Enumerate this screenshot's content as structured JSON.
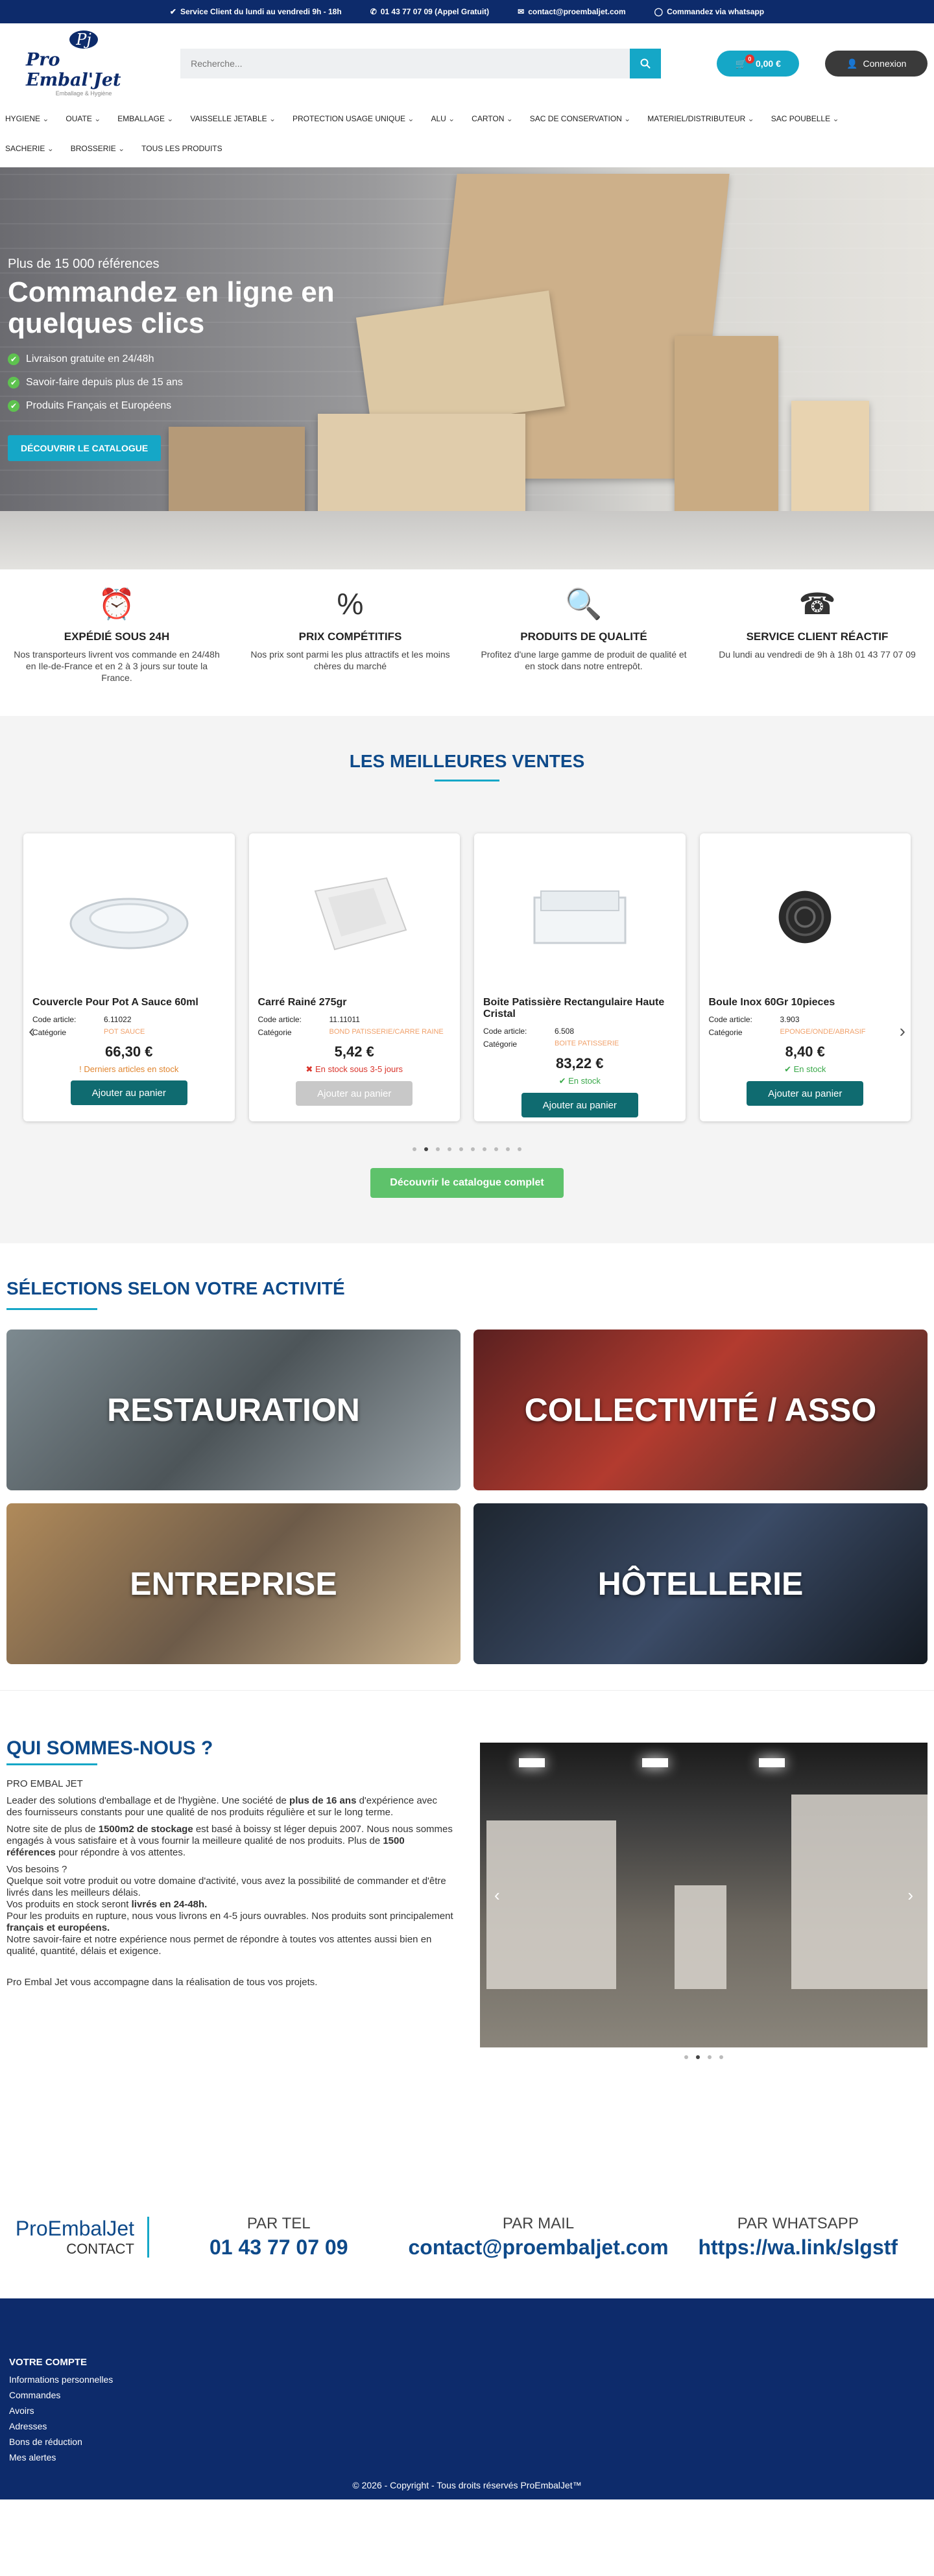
{
  "topbar": {
    "service": "Service Client du lundi au vendredi 9h - 18h",
    "phone": "01 43 77 07 09 (Appel Gratuit)",
    "email": "contact@proembaljet.com",
    "whatsapp": "Commandez via whatsapp"
  },
  "header": {
    "logo_mark": "Pj",
    "logo_name": "Pro Embal'Jet",
    "logo_tag": "Emballage & Hygiène",
    "search_placeholder": "Recherche...",
    "cart_count": "0",
    "cart_total": "0,00 €",
    "login": "Connexion"
  },
  "nav": {
    "row1": [
      "HYGIENE",
      "OUATE",
      "EMBALLAGE",
      "VAISSELLE JETABLE",
      "PROTECTION USAGE UNIQUE",
      "ALU",
      "CARTON",
      "SAC DE CONSERVATION",
      "MATERIEL/DISTRIBUTEUR",
      "SAC POUBELLE"
    ],
    "row2": [
      "SACHERIE",
      "BROSSERIE",
      "TOUS LES PRODUITS"
    ]
  },
  "hero": {
    "kicker": "Plus de 15 000 références",
    "title": "Commandez en ligne en quelques clics",
    "bullets": [
      "Livraison gratuite en 24/48h",
      "Savoir-faire depuis plus de 15 ans",
      "Produits Français et Européens"
    ],
    "cta": "DÉCOUVRIR LE CATALOGUE"
  },
  "features": [
    {
      "icon": "⏰",
      "title": "EXPÉDIÉ SOUS 24H",
      "text": "Nos transporteurs livrent vos commande en 24/48h en Ile-de-France et en 2 à 3 jours sur toute la France."
    },
    {
      "icon": "%",
      "title": "PRIX COMPÉTITIFS",
      "text": "Nos prix sont parmi les plus attractifs et les moins chères du marché"
    },
    {
      "icon": "🔍",
      "title": "PRODUITS DE QUALITÉ",
      "text": "Profitez d'une large gamme de produit de qualité et en stock dans notre entrepôt."
    },
    {
      "icon": "☎",
      "title": "SERVICE CLIENT RÉACTIF",
      "text": "Du lundi au vendredi de 9h à 18h 01 43 77 07 09"
    }
  ],
  "best": {
    "title": "LES MEILLEURES VENTES",
    "code_label": "Code article:",
    "cat_label": "Catégorie",
    "discover": "Découvrir le catalogue complet",
    "products": [
      {
        "name": "Couvercle Pour Pot A Sauce 60ml",
        "code": "6.11022",
        "cat": "POT SAUCE",
        "price": "66,30 €",
        "stock": "Derniers articles en stock",
        "stock_color": "#e0852f",
        "stock_icon": "!",
        "btn": "Ajouter au panier",
        "disabled": false
      },
      {
        "name": "Carré Rainé 275gr",
        "code": "11.11011",
        "cat": "BOND PATISSERIE/CARRE RAINE",
        "price": "5,42 €",
        "stock": "En stock sous 3-5 jours",
        "stock_color": "#d9342b",
        "stock_icon": "✖",
        "btn": "Ajouter au panier",
        "disabled": true
      },
      {
        "name": "Boite Patissière Rectangulaire Haute Cristal",
        "code": "6.508",
        "cat": "BOITE PATISSERIE",
        "price": "83,22 €",
        "stock": "En stock",
        "stock_color": "#3aa94a",
        "stock_icon": "✔",
        "btn": "Ajouter au panier",
        "disabled": false
      },
      {
        "name": "Boule Inox 60Gr 10pieces",
        "code": "3.903",
        "cat": "EPONGE/ONDE/ABRASIF",
        "price": "8,40 €",
        "stock": "En stock",
        "stock_color": "#3aa94a",
        "stock_icon": "✔",
        "btn": "Ajouter au panier",
        "disabled": false
      }
    ]
  },
  "activity": {
    "title": "SÉLECTIONS SELON VOTRE ACTIVITÉ",
    "tiles": [
      "RESTAURATION",
      "COLLECTIVITÉ / ASSO",
      "ENTREPRISE",
      "HÔTELLERIE"
    ]
  },
  "about": {
    "title": "QUI SOMMES-NOUS ?",
    "p1": "PRO EMBAL JET",
    "p2a": "Leader des solutions d'emballage et de l'hygiène. Une société de ",
    "p2b": "plus de 16 ans",
    "p2c": " d'expérience avec des fournisseurs constants pour une qualité de nos produits régulière et sur le long terme.",
    "p3a": "Notre site de plus de ",
    "p3b": "1500m2 de stockage",
    "p3c": " est basé à boissy st léger depuis 2007. Nous nous sommes engagés à vous satisfaire et à vous fournir la meilleure qualité de nos produits. Plus de ",
    "p3d": "1500 références",
    "p3e": " pour répondre à vos attentes.",
    "p4": "Vos besoins ?",
    "p5": "Quelque soit votre produit ou votre domaine d'activité, vous avez la possibilité de commander et d'être livrés dans les meilleurs délais.",
    "p6a": "Vos produits en stock seront ",
    "p6b": "livrés en 24-48h.",
    "p7a": "Pour les produits en rupture, nous vous livrons en 4-5 jours ouvrables. Nos produits sont principalement ",
    "p7b": "français et européens.",
    "p8": "Notre savoir-faire et notre expérience nous permet de répondre à toutes vos attentes aussi bien en qualité, quantité, délais et exigence.",
    "p9": "Pro Embal Jet vous accompagne dans la réalisation de tous vos projets."
  },
  "contact": {
    "brand": "ProEmbalJet",
    "brand_sub": "CONTACT",
    "tel_label": "PAR TEL",
    "tel": "01 43 77 07 09",
    "mail_label": "PAR MAIL",
    "mail": "contact@proembaljet.com",
    "wa_label": "PAR WHATSAPP",
    "wa": "https://wa.link/slgstf"
  },
  "footer": {
    "title": "VOTRE COMPTE",
    "links": [
      "Informations personnelles",
      "Commandes",
      "Avoirs",
      "Adresses",
      "Bons de réduction",
      "Mes alertes"
    ],
    "copy": "© 2026 - Copyright - Tous droits réservés ProEmbalJet™"
  }
}
